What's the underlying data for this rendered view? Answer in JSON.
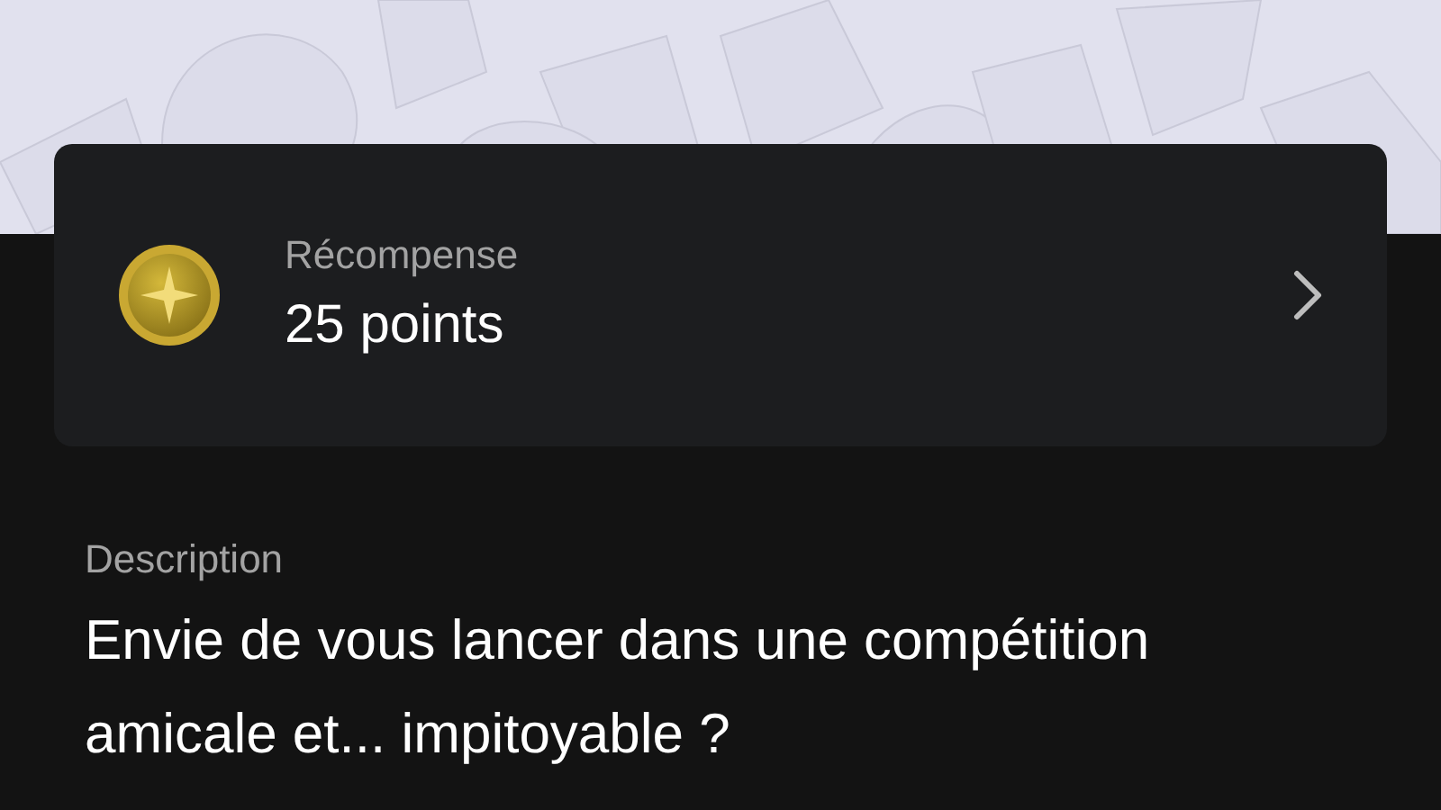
{
  "reward": {
    "label": "Récompense",
    "value": "25 points"
  },
  "description": {
    "label": "Description",
    "text": "Envie de vous lancer dans une compétition amicale et... impitoyable ?"
  }
}
